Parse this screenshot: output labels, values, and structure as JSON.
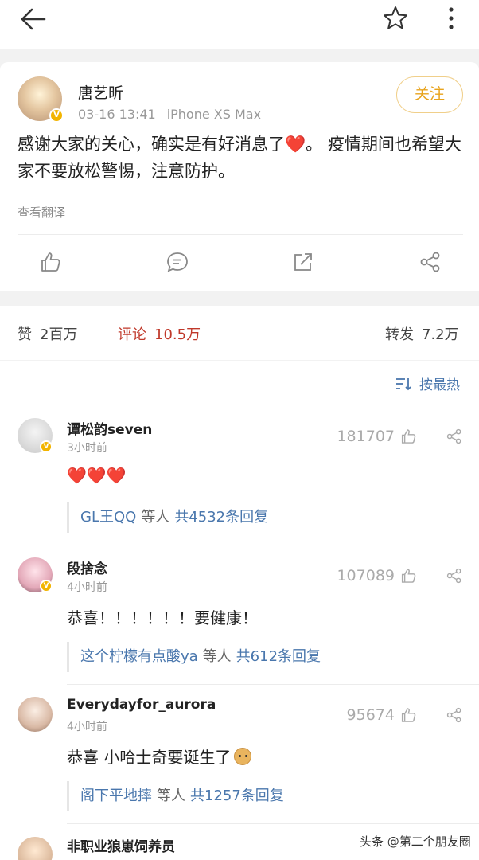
{
  "post": {
    "author": "唐艺昕",
    "time": "03-16 13:41",
    "device": "iPhone XS Max",
    "follow_label": "关注",
    "text_before_heart": "感谢大家的关心，确实是有好消息了",
    "heart": "❤️",
    "text_after_heart": "。 疫情期间也希望大家不要放松警惕，注意防护。",
    "translate_label": "查看翻译"
  },
  "stats": {
    "likes_label": "赞",
    "likes_value": "2百万",
    "comments_label": "评论",
    "comments_value": "10.5万",
    "reposts_label": "转发",
    "reposts_value": "7.2万"
  },
  "sort_label": "按最热",
  "comments": [
    {
      "name": "谭松韵seven",
      "time": "3小时前",
      "likes": "181707",
      "text": "❤️❤️❤️",
      "reply_name": "GL王QQ",
      "reply_mid": "等人",
      "reply_count": "共4532条回复"
    },
    {
      "name": "段捨念",
      "time": "4小时前",
      "likes": "107089",
      "text": "恭喜！！！！！！要健康！",
      "reply_name": "这个柠檬有点酸ya",
      "reply_mid": "等人",
      "reply_count": "共612条回复"
    },
    {
      "name": "Everydayfor_aurora",
      "time": "4小时前",
      "likes": "95674",
      "text": "恭喜 小哈士奇要诞生了",
      "reply_name": "阁下平地摔",
      "reply_mid": "等人",
      "reply_count": "共1257条回复"
    }
  ],
  "partial_comment_name": "非职业狼崽饲养员",
  "watermark": "头条 @第二个朋友圈",
  "colors": {
    "accent_gold": "#e8a31c",
    "link_blue": "#4a77ad",
    "comment_red": "#c0392b"
  },
  "icons": {
    "back": "back-arrow-icon",
    "star": "star-icon",
    "more": "more-vertical-icon",
    "like": "thumbs-up-icon",
    "comment": "comment-icon",
    "repost": "repost-icon",
    "share": "share-icon",
    "sort": "sort-icon",
    "verified": "verified-badge-icon"
  }
}
